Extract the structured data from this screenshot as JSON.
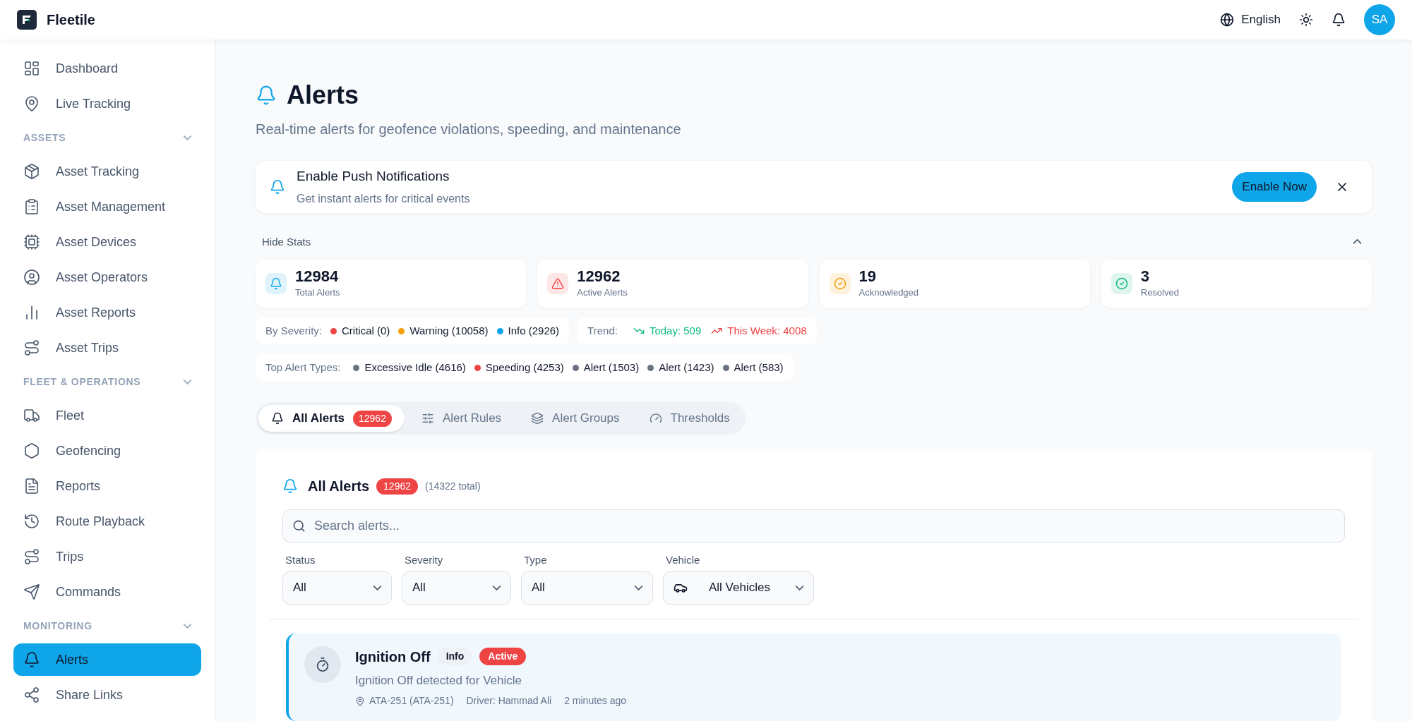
{
  "header": {
    "brand": "Fleetile",
    "language": "English",
    "avatar": "SA"
  },
  "sidebar": {
    "items": [
      {
        "kind": "item",
        "label": "Dashboard",
        "selected": false
      },
      {
        "kind": "item",
        "label": "Live Tracking",
        "selected": false
      },
      {
        "kind": "section",
        "label": "ASSETS",
        "expanded": true
      },
      {
        "kind": "item",
        "label": "Asset Tracking",
        "selected": false
      },
      {
        "kind": "item",
        "label": "Asset Management",
        "selected": false
      },
      {
        "kind": "item",
        "label": "Asset Devices",
        "selected": false
      },
      {
        "kind": "item",
        "label": "Asset Operators",
        "selected": false
      },
      {
        "kind": "item",
        "label": "Asset Reports",
        "selected": false
      },
      {
        "kind": "item",
        "label": "Asset Trips",
        "selected": false
      },
      {
        "kind": "section",
        "label": "FLEET & OPERATIONS",
        "expanded": true
      },
      {
        "kind": "item",
        "label": "Fleet",
        "selected": false
      },
      {
        "kind": "item",
        "label": "Geofencing",
        "selected": false
      },
      {
        "kind": "item",
        "label": "Reports",
        "selected": false
      },
      {
        "kind": "item",
        "label": "Route Playback",
        "selected": false
      },
      {
        "kind": "item",
        "label": "Trips",
        "selected": false
      },
      {
        "kind": "item",
        "label": "Commands",
        "selected": false
      },
      {
        "kind": "section",
        "label": "MONITORING",
        "expanded": true
      },
      {
        "kind": "item",
        "label": "Alerts",
        "selected": true
      },
      {
        "kind": "item",
        "label": "Share Links",
        "selected": false
      }
    ]
  },
  "page": {
    "title": "Alerts",
    "subtitle": "Real-time alerts for geofence violations, speeding, and maintenance"
  },
  "push_banner": {
    "title": "Enable Push Notifications",
    "text": "Get instant alerts for critical events",
    "button": "Enable Now"
  },
  "stats": {
    "toggle": "Hide Stats",
    "expanded": true,
    "cards": [
      {
        "value": "12984",
        "label": "Total Alerts",
        "color": "#0ea5e9"
      },
      {
        "value": "12962",
        "label": "Active Alerts",
        "color": "#ef4444"
      },
      {
        "value": "19",
        "label": "Acknowledged",
        "color": "#f59e0b"
      },
      {
        "value": "3",
        "label": "Resolved",
        "color": "#10b981"
      }
    ],
    "severity_label": "By Severity:",
    "severity": [
      {
        "label": "Critical (0)",
        "color": "#ef4444"
      },
      {
        "label": "Warning (10058)",
        "color": "#f59e0b"
      },
      {
        "label": "Info (2926)",
        "color": "#0ea5e9"
      }
    ],
    "trend_label": "Trend:",
    "trend": [
      {
        "kind": "down",
        "label": "Today: 509",
        "color": "#10b981"
      },
      {
        "kind": "up",
        "label": "This Week: 4008",
        "color": "#ef4444"
      }
    ],
    "types_label": "Top Alert Types:",
    "types": [
      {
        "label": "Excessive Idle (4616)",
        "color": "#6b7280"
      },
      {
        "label": "Speeding (4253)",
        "color": "#ef4444"
      },
      {
        "label": "Alert (1503)",
        "color": "#6b7280"
      },
      {
        "label": "Alert (1423)",
        "color": "#6b7280"
      },
      {
        "label": "Alert (583)",
        "color": "#6b7280"
      }
    ]
  },
  "tabs": [
    {
      "label": "All Alerts",
      "badge": "12962",
      "selected": true
    },
    {
      "label": "Alert Rules",
      "selected": false
    },
    {
      "label": "Alert Groups",
      "selected": false
    },
    {
      "label": "Thresholds",
      "selected": false
    }
  ],
  "alerts_panel": {
    "title": "All Alerts",
    "badge": "12962",
    "total": "(14322 total)",
    "search_placeholder": "Search alerts...",
    "filters": [
      {
        "kind": "plain",
        "label": "Status",
        "value": "All"
      },
      {
        "kind": "plain",
        "label": "Severity",
        "value": "All"
      },
      {
        "kind": "plain",
        "label": "Type",
        "value": "All"
      },
      {
        "kind": "vehicle",
        "label": "Vehicle",
        "value": "All Vehicles"
      }
    ],
    "alerts": [
      {
        "title": "Ignition Off",
        "severity": "Info",
        "status": "Active",
        "description": "Ignition Off detected for Vehicle",
        "location": "ATA-251 (ATA-251)",
        "driver": "Driver: Hammad Ali",
        "time": "2 minutes ago"
      }
    ]
  }
}
